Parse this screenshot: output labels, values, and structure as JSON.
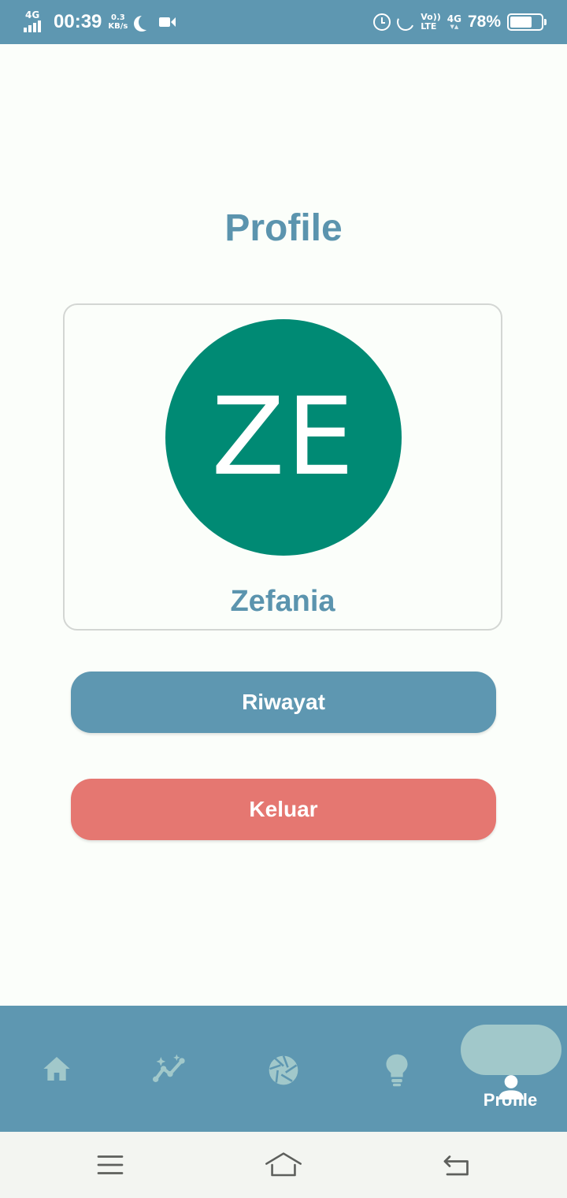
{
  "status_bar": {
    "network": "4G",
    "time": "00:39",
    "speed_value": "0.3",
    "speed_unit": "KB/s",
    "volte_top": "Vo))",
    "volte_bottom": "LTE",
    "net_type": "4G",
    "battery_percent": "78%",
    "battery_level": 0.78,
    "icons": [
      "signal-icon",
      "moon-icon",
      "video-icon",
      "alarm-icon",
      "moon-outline-icon",
      "battery-icon"
    ]
  },
  "page": {
    "title": "Profile"
  },
  "profile": {
    "initials": "ZE",
    "name": "Zefania",
    "avatar_color": "#008a74"
  },
  "actions": {
    "history_label": "Riwayat",
    "logout_label": "Keluar"
  },
  "bottom_nav": {
    "items": [
      {
        "icon": "home-icon",
        "label": ""
      },
      {
        "icon": "trend-chart-icon",
        "label": ""
      },
      {
        "icon": "camera-aperture-icon",
        "label": ""
      },
      {
        "icon": "lightbulb-icon",
        "label": ""
      },
      {
        "icon": "person-icon",
        "label": "Profile"
      }
    ],
    "active_index": 4
  },
  "system_nav": {
    "icons": [
      "menu-icon",
      "home-outline-icon",
      "back-icon"
    ]
  },
  "colors": {
    "primary": "#5e97b1",
    "danger": "#e57771",
    "background": "#fbfefa",
    "active_pill": "#a1c8ca"
  }
}
